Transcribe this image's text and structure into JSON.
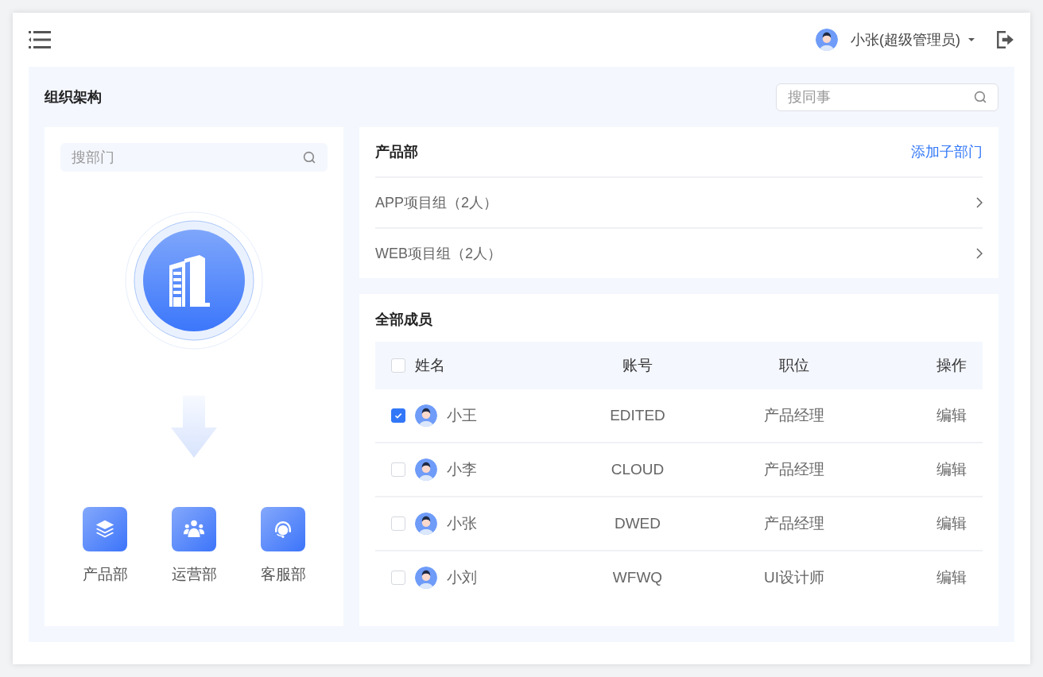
{
  "header": {
    "user": "小张(超级管理员)"
  },
  "page": {
    "title": "组织架构",
    "search": {
      "placeholder": "搜同事"
    }
  },
  "departments": {
    "search": {
      "placeholder": "搜部门"
    },
    "items": [
      {
        "kind": "layers",
        "label": "产品部"
      },
      {
        "kind": "people",
        "label": "运营部"
      },
      {
        "kind": "headset",
        "label": "客服部"
      }
    ]
  },
  "department": {
    "title": "产品部",
    "action": "添加子部门",
    "groups": [
      {
        "label": "APP项目组（2人）"
      },
      {
        "label": "WEB项目组（2人）"
      }
    ]
  },
  "members": {
    "title": "全部成员",
    "select_all": {
      "checked": false
    },
    "columns": [
      "姓名",
      "账号",
      "职位",
      "操作"
    ],
    "rows": [
      {
        "checked": true,
        "name": "小王",
        "account": "EDITED",
        "position": "产品经理",
        "action": "编辑"
      },
      {
        "checked": false,
        "name": "小李",
        "account": "CLOUD",
        "position": "产品经理",
        "action": "编辑"
      },
      {
        "checked": false,
        "name": "小张",
        "account": "DWED",
        "position": "产品经理",
        "action": "编辑"
      },
      {
        "checked": false,
        "name": "小刘",
        "account": "WFWQ",
        "position": "UI设计师",
        "action": "编辑"
      }
    ]
  }
}
